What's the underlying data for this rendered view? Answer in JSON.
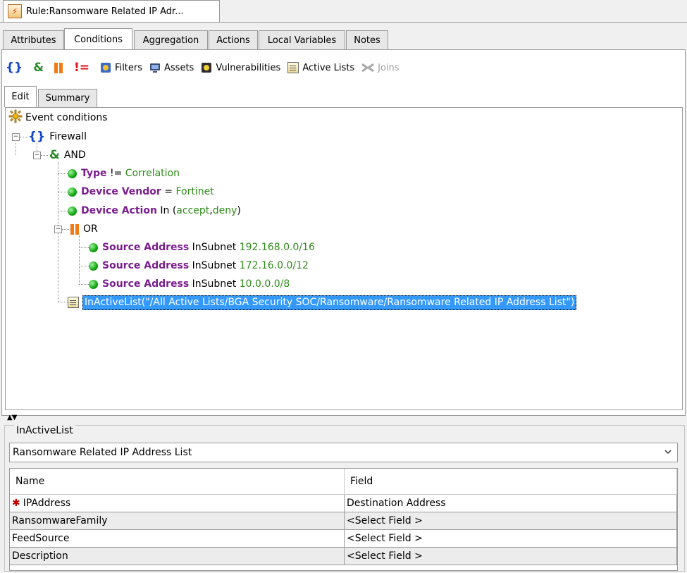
{
  "window": {
    "title": "Rule:Ransomware Related IP Adr..."
  },
  "tabs": [
    "Attributes",
    "Conditions",
    "Aggregation",
    "Actions",
    "Local Variables",
    "Notes"
  ],
  "active_tab": "Conditions",
  "toolbar": {
    "filters": "Filters",
    "assets": "Assets",
    "vulnerabilities": "Vulnerabilities",
    "active_lists": "Active Lists",
    "joins": "Joins",
    "and_symbol": "&",
    "not_symbol": "!="
  },
  "subtabs": [
    "Edit",
    "Summary"
  ],
  "tree": {
    "root": "Event conditions",
    "group": "Firewall",
    "and": "AND",
    "conditions": [
      {
        "field": "Type",
        "op": "!=",
        "value": "Correlation"
      },
      {
        "field": "Device Vendor",
        "op": "=",
        "value": "Fortinet"
      },
      {
        "field": "Device Action",
        "op": "In (",
        "value1": "accept",
        "sep": ",",
        "value2": "deny",
        "close": ")"
      }
    ],
    "or": "OR",
    "or_conditions": [
      {
        "field": "Source Address",
        "op": "InSubnet",
        "value": "192.168.0.0/16"
      },
      {
        "field": "Source Address",
        "op": "InSubnet",
        "value": "172.16.0.0/12"
      },
      {
        "field": "Source Address",
        "op": "InSubnet",
        "value": "10.0.0.0/8"
      }
    ],
    "active_list_expr": "InActiveList(\"/All Active Lists/BGA Security SOC/Ransomware/Ransomware Related IP Address List\")"
  },
  "detail": {
    "legend": "InActiveList",
    "selected_list": "Ransomware Related IP Address List",
    "columns": [
      "Name",
      "Field"
    ],
    "rows": [
      {
        "name": "IPAddress",
        "field": "Destination Address",
        "required": "✱"
      },
      {
        "name": "RansomwareFamily",
        "field": "<Select Field >"
      },
      {
        "name": "FeedSource",
        "field": "<Select Field >"
      },
      {
        "name": "Description",
        "field": "<Select Field >"
      }
    ]
  }
}
